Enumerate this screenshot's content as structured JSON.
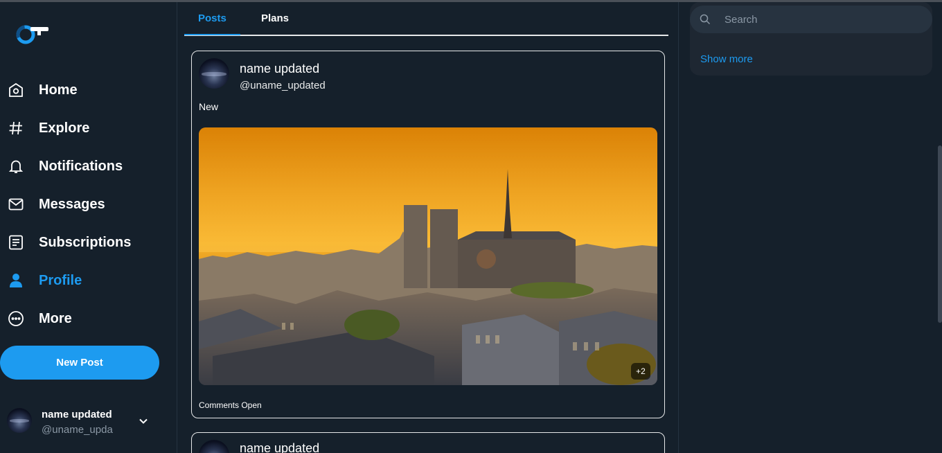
{
  "nav": {
    "items": [
      {
        "label": "Home",
        "icon": "home-icon"
      },
      {
        "label": "Explore",
        "icon": "hashtag-icon"
      },
      {
        "label": "Notifications",
        "icon": "bell-icon"
      },
      {
        "label": "Messages",
        "icon": "envelope-icon"
      },
      {
        "label": "Subscriptions",
        "icon": "document-icon"
      },
      {
        "label": "Profile",
        "icon": "user-icon",
        "active": true
      },
      {
        "label": "More",
        "icon": "more-circle-icon"
      }
    ],
    "new_post_label": "New Post"
  },
  "account": {
    "name": "name updated",
    "handle": "@uname_upda"
  },
  "tabs": [
    {
      "label": "Posts",
      "active": true
    },
    {
      "label": "Plans",
      "active": false
    }
  ],
  "posts": [
    {
      "name": "name updated",
      "handle": "@uname_updated",
      "text": "New",
      "media_more": "+2",
      "footer": "Comments Open"
    },
    {
      "name": "name updated"
    }
  ],
  "search": {
    "placeholder": "Search"
  },
  "show_more_label": "Show more",
  "colors": {
    "background": "#15202b",
    "accent": "#1d9bf0",
    "panel": "#1e2732",
    "muted_text": "#8b98a5"
  }
}
